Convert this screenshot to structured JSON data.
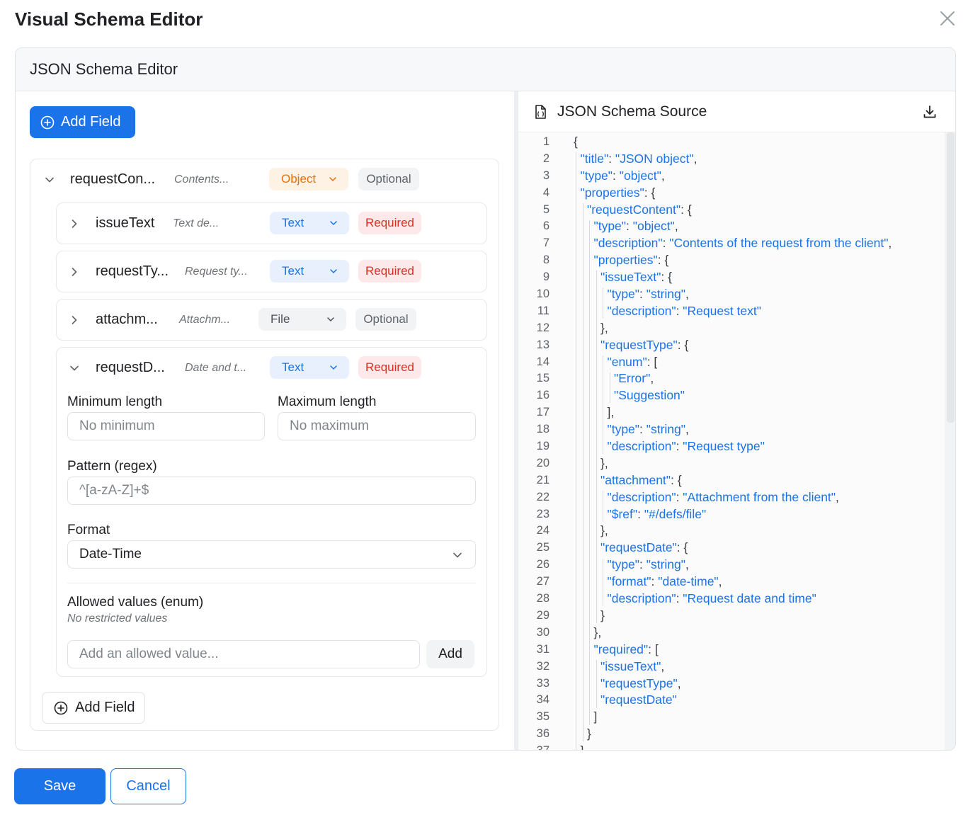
{
  "dialog": {
    "title": "Visual Schema Editor"
  },
  "editor": {
    "title": "JSON Schema Editor"
  },
  "left": {
    "add_field_label": "Add Field",
    "root": {
      "name": "requestCon...",
      "desc": "Contents...",
      "type": "Object",
      "status": "Optional"
    },
    "children": [
      {
        "name": "issueText",
        "desc": "Text de...",
        "type": "Text",
        "status": "Required"
      },
      {
        "name": "requestTy...",
        "desc": "Request ty...",
        "type": "Text",
        "status": "Required"
      },
      {
        "name": "attachm...",
        "desc": "Attachm...",
        "type": "File",
        "status": "Optional"
      },
      {
        "name": "requestD...",
        "desc": "Date and t...",
        "type": "Text",
        "status": "Required"
      }
    ],
    "details": {
      "min_label": "Minimum length",
      "min_placeholder": "No minimum",
      "max_label": "Maximum length",
      "max_placeholder": "No maximum",
      "pattern_label": "Pattern (regex)",
      "pattern_value": "^[a-zA-Z]+$",
      "format_label": "Format",
      "format_value": "Date-Time",
      "enum_label": "Allowed values (enum)",
      "enum_hint": "No restricted values",
      "enum_placeholder": "Add an allowed value...",
      "enum_add": "Add"
    },
    "add_nested_label": "Add Field"
  },
  "source": {
    "title": "JSON Schema Source",
    "lines": [
      "{",
      "\"title\": \"JSON object\",",
      "\"type\": \"object\",",
      "\"properties\": {",
      "\"requestContent\": {",
      "\"type\": \"object\",",
      "\"description\": \"Contents of the request from the client\",",
      "\"properties\": {",
      "\"issueText\": {",
      "\"type\": \"string\",",
      "\"description\": \"Request text\"",
      "},",
      "\"requestType\": {",
      "\"enum\": [",
      "\"Error\",",
      "\"Suggestion\"",
      "],",
      "\"type\": \"string\",",
      "\"description\": \"Request type\"",
      "},",
      "\"attachment\": {",
      "\"description\": \"Attachment from the client\",",
      "\"$ref\": \"#/defs/file\"",
      "},",
      "\"requestDate\": {",
      "\"type\": \"string\",",
      "\"format\": \"date-time\",",
      "\"description\": \"Request date and time\"",
      "}",
      "},",
      "\"required\": [",
      "\"issueText\",",
      "\"requestType\",",
      "\"requestDate\"",
      "]",
      "}",
      "}"
    ]
  },
  "footer": {
    "save_label": "Save",
    "cancel_label": "Cancel"
  },
  "icons": {
    "close": "close-icon",
    "plus": "plus-circle-icon",
    "file": "json-file-icon",
    "download": "download-icon",
    "chevron": "chevron-icon"
  },
  "colors": {
    "primary": "#1a73e8",
    "object": "#e8710a",
    "required": "#d93025"
  }
}
